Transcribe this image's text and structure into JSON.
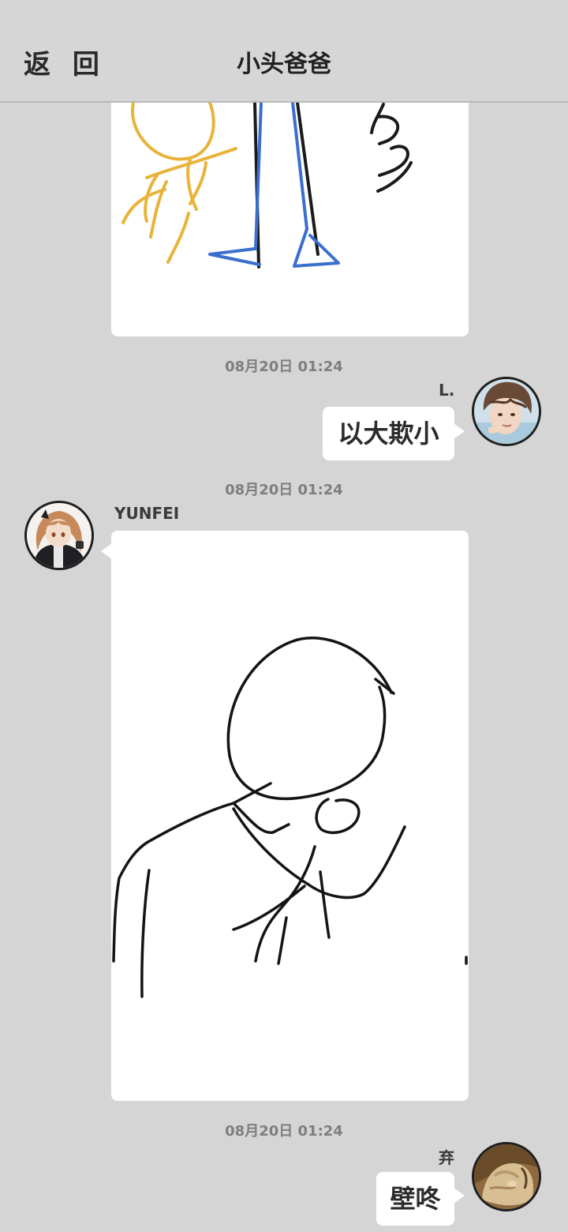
{
  "header": {
    "back_label": "返 回",
    "title": "小头爸爸"
  },
  "messages": [
    {
      "type": "image",
      "direction": "incoming",
      "description_name": "drawing-stick-figures"
    },
    {
      "type": "timestamp",
      "text": "08月20日  01:24"
    },
    {
      "type": "text",
      "direction": "outgoing",
      "sender": "L.",
      "text": "以大欺小"
    },
    {
      "type": "timestamp",
      "text": "08月20日  01:24"
    },
    {
      "type": "image",
      "direction": "incoming",
      "sender": "YUNFEI"
    },
    {
      "type": "timestamp",
      "text": "08月20日  01:24"
    },
    {
      "type": "text",
      "direction": "outgoing",
      "sender": "弃",
      "text": "壁咚"
    }
  ],
  "colors": {
    "background": "#d5d5d5",
    "bubble": "#ffffff",
    "text": "#2b2b2b",
    "timestamp": "#7e7e7e"
  }
}
